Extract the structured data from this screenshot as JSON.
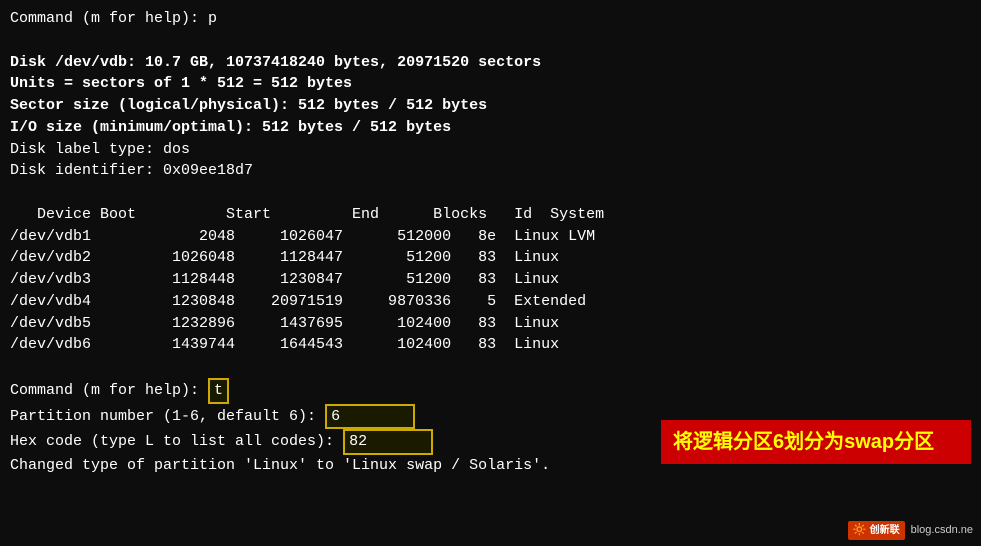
{
  "terminal": {
    "lines": [
      {
        "id": "cmd1",
        "text": "Command (m for help): p",
        "bold": false
      },
      {
        "id": "spacer1",
        "text": "",
        "bold": false
      },
      {
        "id": "disk_info",
        "text": "Disk /dev/vdb: 10.7 GB, 10737418240 bytes, 20971520 sectors",
        "bold": true
      },
      {
        "id": "units",
        "text": "Units = sectors of 1 * 512 = 512 bytes",
        "bold": true
      },
      {
        "id": "sector_size",
        "text": "Sector size (logical/physical): 512 bytes / 512 bytes",
        "bold": true
      },
      {
        "id": "io_size",
        "text": "I/O size (minimum/optimal): 512 bytes / 512 bytes",
        "bold": true
      },
      {
        "id": "label_type",
        "text": "Disk label type: dos",
        "bold": false
      },
      {
        "id": "identifier",
        "text": "Disk identifier: 0x09ee18d7",
        "bold": false
      },
      {
        "id": "spacer2",
        "text": "",
        "bold": false
      },
      {
        "id": "table_header",
        "text": "   Device Boot          Start         End      Blocks   Id  System",
        "bold": false
      },
      {
        "id": "vdb1",
        "text": "/dev/vdb1            2048     1026047      512000   8e  Linux LVM",
        "bold": false
      },
      {
        "id": "vdb2",
        "text": "/dev/vdb2         1026048     1128447       51200   83  Linux",
        "bold": false
      },
      {
        "id": "vdb3",
        "text": "/dev/vdb3         1128448     1230847       51200   83  Linux",
        "bold": false
      },
      {
        "id": "vdb4",
        "text": "/dev/vdb4         1230848    20971519     9870336    5  Extended",
        "bold": false
      },
      {
        "id": "vdb5",
        "text": "/dev/vdb5         1232896     1437695      102400   83  Linux",
        "bold": false
      },
      {
        "id": "vdb6",
        "text": "/dev/vdb6         1439744     1644543      102400   83  Linux",
        "bold": false
      },
      {
        "id": "spacer3",
        "text": "",
        "bold": false
      }
    ],
    "cmd2_prefix": "Command (m for help): ",
    "cmd2_value": "t",
    "partition_prefix": "Partition number (1-6, default 6): ",
    "partition_value": "6",
    "hex_prefix": "Hex code (type L to list all codes): ",
    "hex_value": "82",
    "changed_line": "Changed type of partition 'Linux' to 'Linux swap / Solaris'."
  },
  "annotation": {
    "text": "将逻辑分区6划分为swap分区"
  },
  "watermark": {
    "logo_line1": "创新联",
    "logo_line2": "",
    "url": "blog.csdn.ne"
  }
}
